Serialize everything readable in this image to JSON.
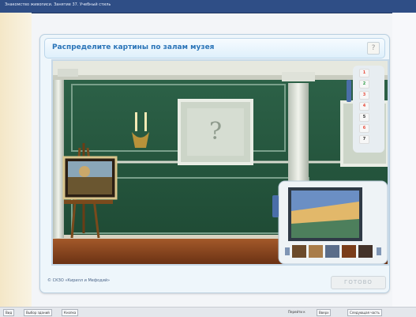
{
  "top_bar": {
    "text": "Знакомство живописи. Занятие 37. Учебный стиль"
  },
  "title": "Распределите картины по залам музея",
  "help_symbol": "?",
  "scene": {
    "frame_placeholder": "?",
    "numbers": [
      "1",
      "2",
      "3",
      "4",
      "5",
      "6",
      "7"
    ],
    "number_colors": [
      "#e74c3c",
      "#2e9b46",
      "#e74c3c",
      "#e74c3c",
      "#333333",
      "#e74c3c",
      "#333333"
    ]
  },
  "footer_note": "© СКЗО «Кирилл и Мефодий»",
  "ready_label": "ГОТОВО",
  "status_bar": {
    "left_items": [
      "Вид",
      "Выбор зданий",
      "Кнопка"
    ],
    "right_items": [
      "Перейти к",
      "Вверх",
      "Следующая часть"
    ]
  },
  "colors": {
    "wall": "#2f6a4c",
    "accent": "#2a74b8"
  }
}
